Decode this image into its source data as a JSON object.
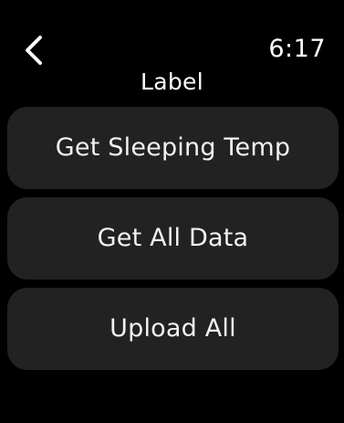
{
  "status": {
    "back_icon": "chevron-left-icon",
    "time": "6:17"
  },
  "header": {
    "title": "Label"
  },
  "actions": [
    {
      "label": "Get Sleeping Temp"
    },
    {
      "label": "Get All Data"
    },
    {
      "label": "Upload All"
    }
  ],
  "colors": {
    "background": "#000000",
    "button_background": "#222222",
    "text": "#ffffff"
  }
}
